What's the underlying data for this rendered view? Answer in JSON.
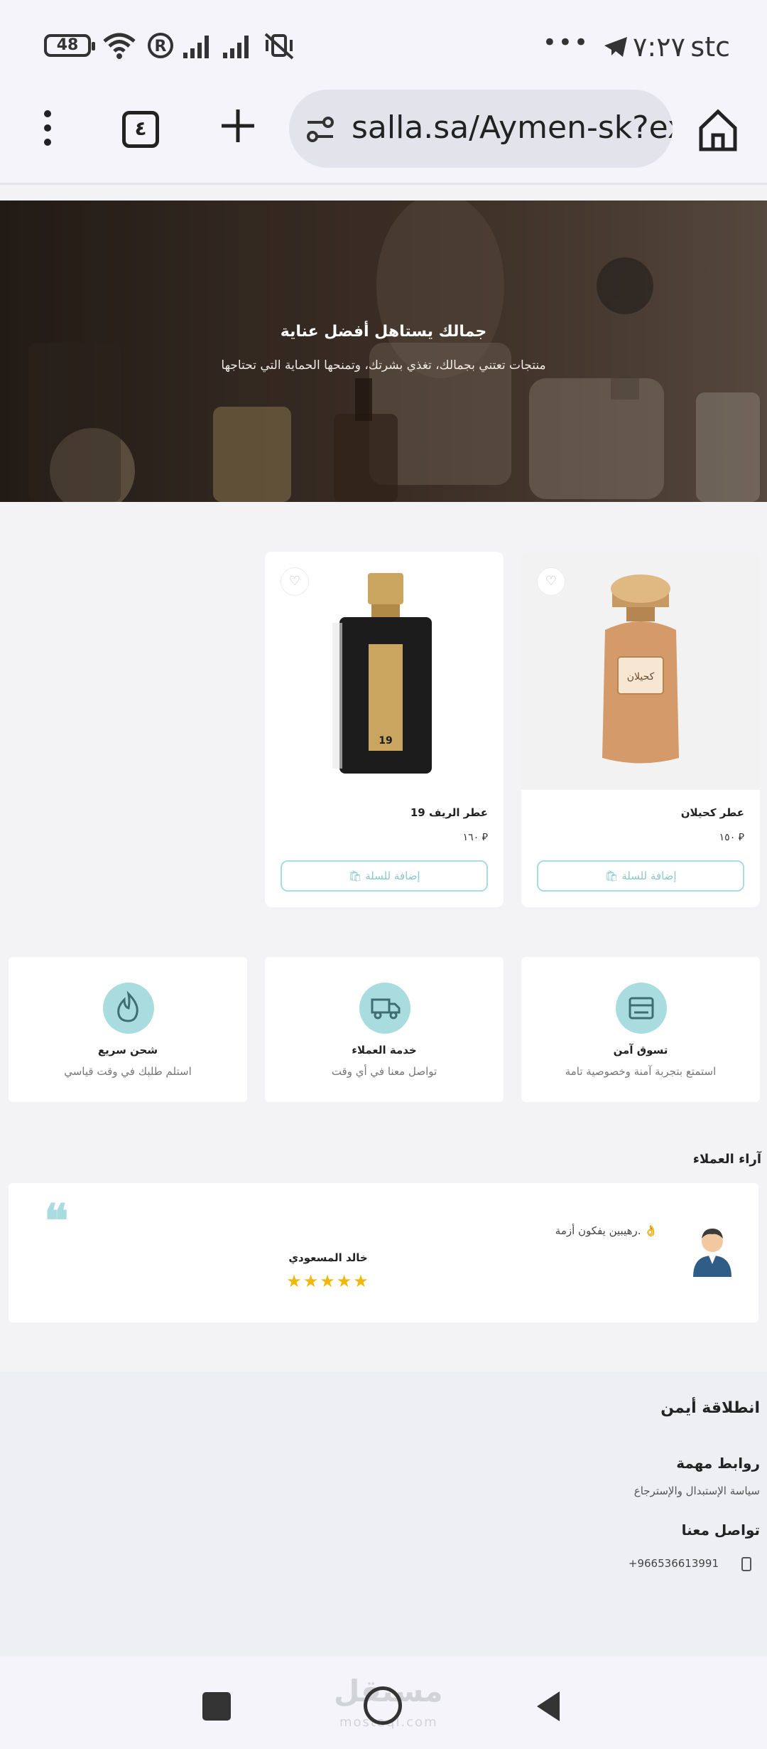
{
  "status_bar": {
    "time": "٧:٢٧",
    "carrier": "stc",
    "battery": "48",
    "more": "•••"
  },
  "browser": {
    "url": "salla.sa/Aymen-sk?exp",
    "tab_count": "٤"
  },
  "hero": {
    "title": "جمالك يستاهل أفضل عناية",
    "subtitle": "منتجات تعتني بجمالك، تغذي بشرتك، وتمنحها الحماية التي تحتاجها"
  },
  "products": [
    {
      "name": "عطر كحيلان",
      "price": "١٥٠ ⃁",
      "add_label": "إضافة للسلة"
    },
    {
      "name": "عطر الريف 19",
      "price": "١٦٠ ⃁",
      "add_label": "إضافة للسلة"
    }
  ],
  "features": [
    {
      "title": "تسوق آمن",
      "desc": "استمتع بتجربة آمنة وخصوصية تامة",
      "icon": "store-icon"
    },
    {
      "title": "خدمة العملاء",
      "desc": "تواصل معنا في أي وقت",
      "icon": "delivery-truck-icon"
    },
    {
      "title": "شحن سريع",
      "desc": "استلم طلبك في وقت قياسي",
      "icon": "fire-icon"
    }
  ],
  "testimonials": {
    "title": "آراء العملاء",
    "items": [
      {
        "text": "رهيبين يفكون أزمة. 👌",
        "name": "خالد المسعودي",
        "stars": "★★★★★",
        "rating": 5
      }
    ]
  },
  "footer": {
    "store_name": "انطلاقة أيمن",
    "links_title": "روابط مهمة",
    "links": [
      "سياسة الإستبدال والإسترجاع"
    ],
    "contact_title": "تواصل معنا",
    "phone": "+966536613991"
  },
  "watermark": {
    "main": "مستقل",
    "sub": "mostaql.com"
  },
  "colors": {
    "accent": "#a9dcdf",
    "star": "#f1b80b"
  }
}
